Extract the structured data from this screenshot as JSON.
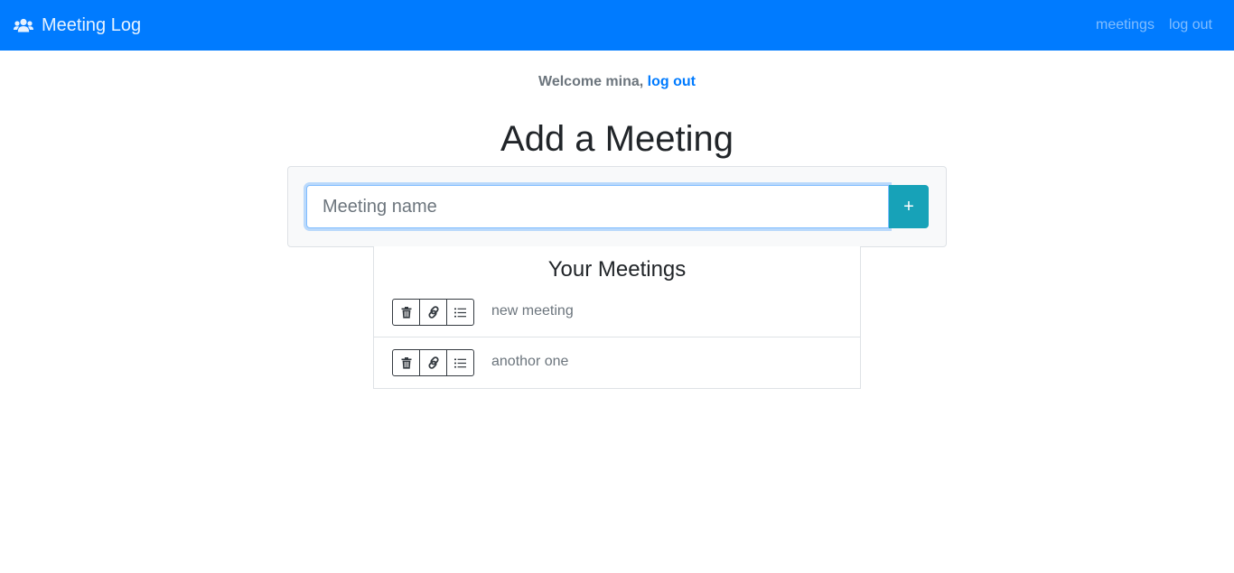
{
  "navbar": {
    "brand_icon": "users-icon",
    "brand_label": "Meeting Log",
    "links": [
      {
        "label": "meetings"
      },
      {
        "label": "log out"
      }
    ]
  },
  "welcome": {
    "text": "Welcome mina",
    "separator": ",",
    "logout_label": "log out"
  },
  "add_meeting": {
    "title": "Add a Meeting",
    "input_value": "",
    "input_placeholder": "Meeting name",
    "add_button_label": "+"
  },
  "meetings": {
    "title": "Your Meetings",
    "items": [
      {
        "name": "new meeting",
        "actions": [
          "trash-icon",
          "link-icon",
          "list-icon"
        ]
      },
      {
        "name": "anothor one",
        "actions": [
          "trash-icon",
          "link-icon",
          "list-icon"
        ]
      }
    ]
  },
  "colors": {
    "navbar": "#007bff",
    "add_button": "#17a2b8",
    "link": "#007bff"
  }
}
